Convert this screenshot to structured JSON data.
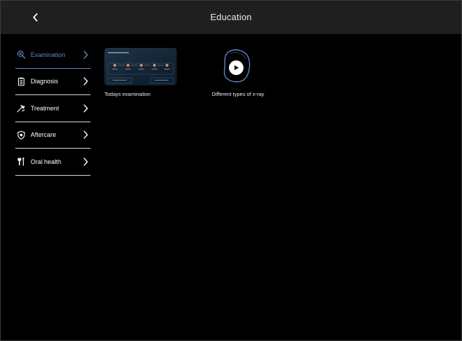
{
  "header": {
    "title": "Education"
  },
  "sidebar": {
    "items": [
      {
        "label": "Examination",
        "icon": "magnifier-icon",
        "active": true
      },
      {
        "label": "Diagnosis",
        "icon": "clipboard-icon",
        "active": false
      },
      {
        "label": "Treatment",
        "icon": "dental-lamp-icon",
        "active": false
      },
      {
        "label": "Aftercare",
        "icon": "shield-icon",
        "active": false
      },
      {
        "label": "Oral health",
        "icon": "toothbrush-icon",
        "active": false
      }
    ]
  },
  "content": {
    "cards": [
      {
        "caption": "Todays examination",
        "type": "presentation"
      },
      {
        "caption": "Different types of x-ray",
        "type": "video"
      }
    ]
  },
  "colors": {
    "accent": "#5e86c9",
    "header_bg": "#1f1f1f",
    "background": "#000000",
    "divider": "#d9d9d9"
  }
}
